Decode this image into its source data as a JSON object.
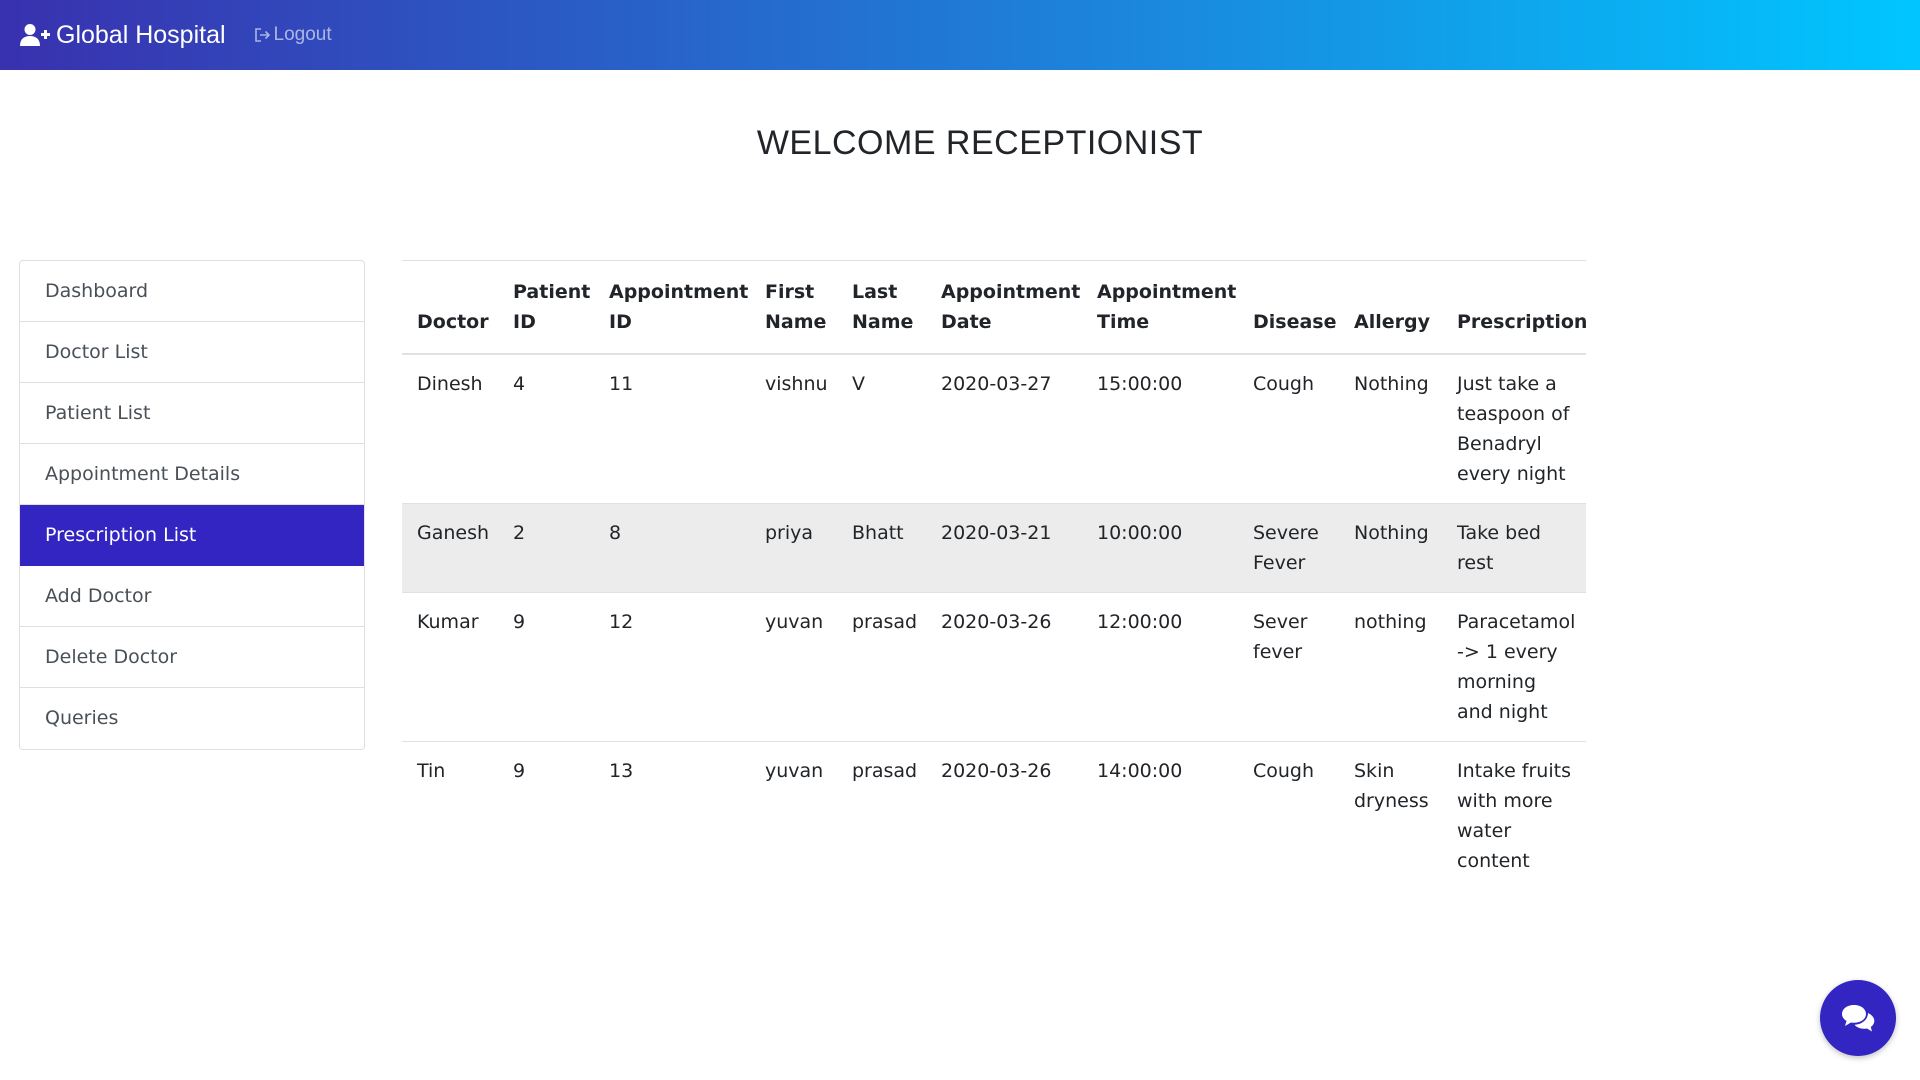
{
  "navbar": {
    "brand": "Global Hospital",
    "brand_icon": "user-plus-icon",
    "logout_label": "Logout",
    "logout_icon": "sign-out-icon",
    "gradient": [
      "#3931af",
      "#00c6ff"
    ]
  },
  "welcome": "WELCOME RECEPTIONIST",
  "sidebar": {
    "items": [
      {
        "label": "Dashboard"
      },
      {
        "label": "Doctor List"
      },
      {
        "label": "Patient List"
      },
      {
        "label": "Appointment Details"
      },
      {
        "label": "Prescription List"
      },
      {
        "label": "Add Doctor"
      },
      {
        "label": "Delete Doctor"
      },
      {
        "label": "Queries"
      }
    ],
    "active_index": 4,
    "active_color": "#3225c2"
  },
  "table": {
    "headers": [
      "Doctor",
      "Patient ID",
      "Appointment ID",
      "First Name",
      "Last Name",
      "Appointment Date",
      "Appointment Time",
      "Disease",
      "Allergy",
      "Prescription"
    ],
    "rows": [
      [
        "Dinesh",
        "4",
        "11",
        "vishnu",
        "V",
        "2020-03-27",
        "15:00:00",
        "Cough",
        "Nothing",
        "Just take a teaspoon of Benadryl every night"
      ],
      [
        "Ganesh",
        "2",
        "8",
        "priya",
        "Bhatt",
        "2020-03-21",
        "10:00:00",
        "Severe Fever",
        "Nothing",
        "Take bed rest"
      ],
      [
        "Kumar",
        "9",
        "12",
        "yuvan",
        "prasad",
        "2020-03-26",
        "12:00:00",
        "Sever fever",
        "nothing",
        "Paracetamol -> 1 every morning and night"
      ],
      [
        "Tin",
        "9",
        "13",
        "yuvan",
        "prasad",
        "2020-03-26",
        "14:00:00",
        "Cough",
        "Skin dryness",
        "Intake fruits with more water content"
      ]
    ]
  },
  "chat_button": {
    "icon": "chat-bubbles-icon",
    "color": "#3225c2"
  }
}
